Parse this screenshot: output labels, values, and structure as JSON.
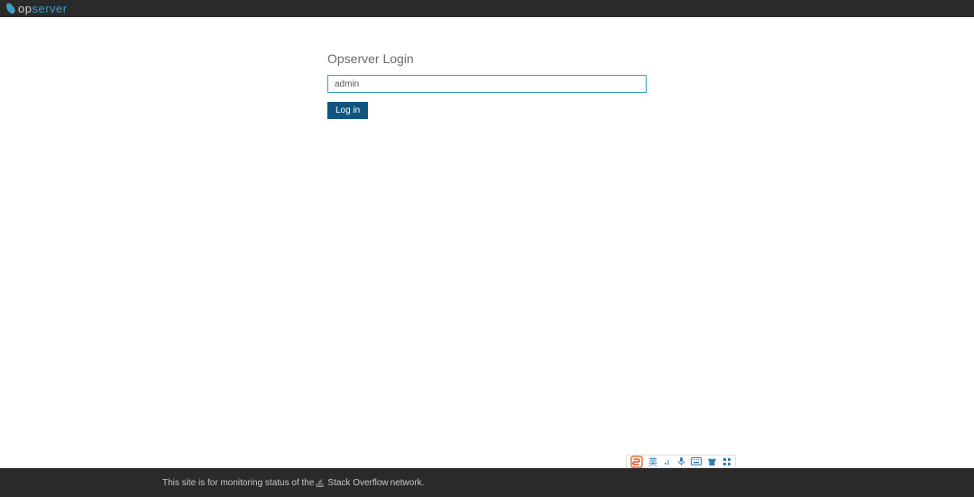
{
  "header": {
    "logo_prefix": "op",
    "logo_suffix": "server"
  },
  "login": {
    "title": "Opserver Login",
    "username_value": "admin",
    "button_label": "Log in"
  },
  "footer": {
    "text_before": "This site is for monitoring status of the ",
    "link_text": "Stack Overflow",
    "text_after": " network."
  },
  "ime": {
    "lang": "英",
    "items": [
      "",
      "",
      "",
      "",
      ""
    ]
  },
  "colors": {
    "header_bg": "#2a2a2a",
    "accent": "#3a9fc4",
    "button_bg": "#105580"
  }
}
